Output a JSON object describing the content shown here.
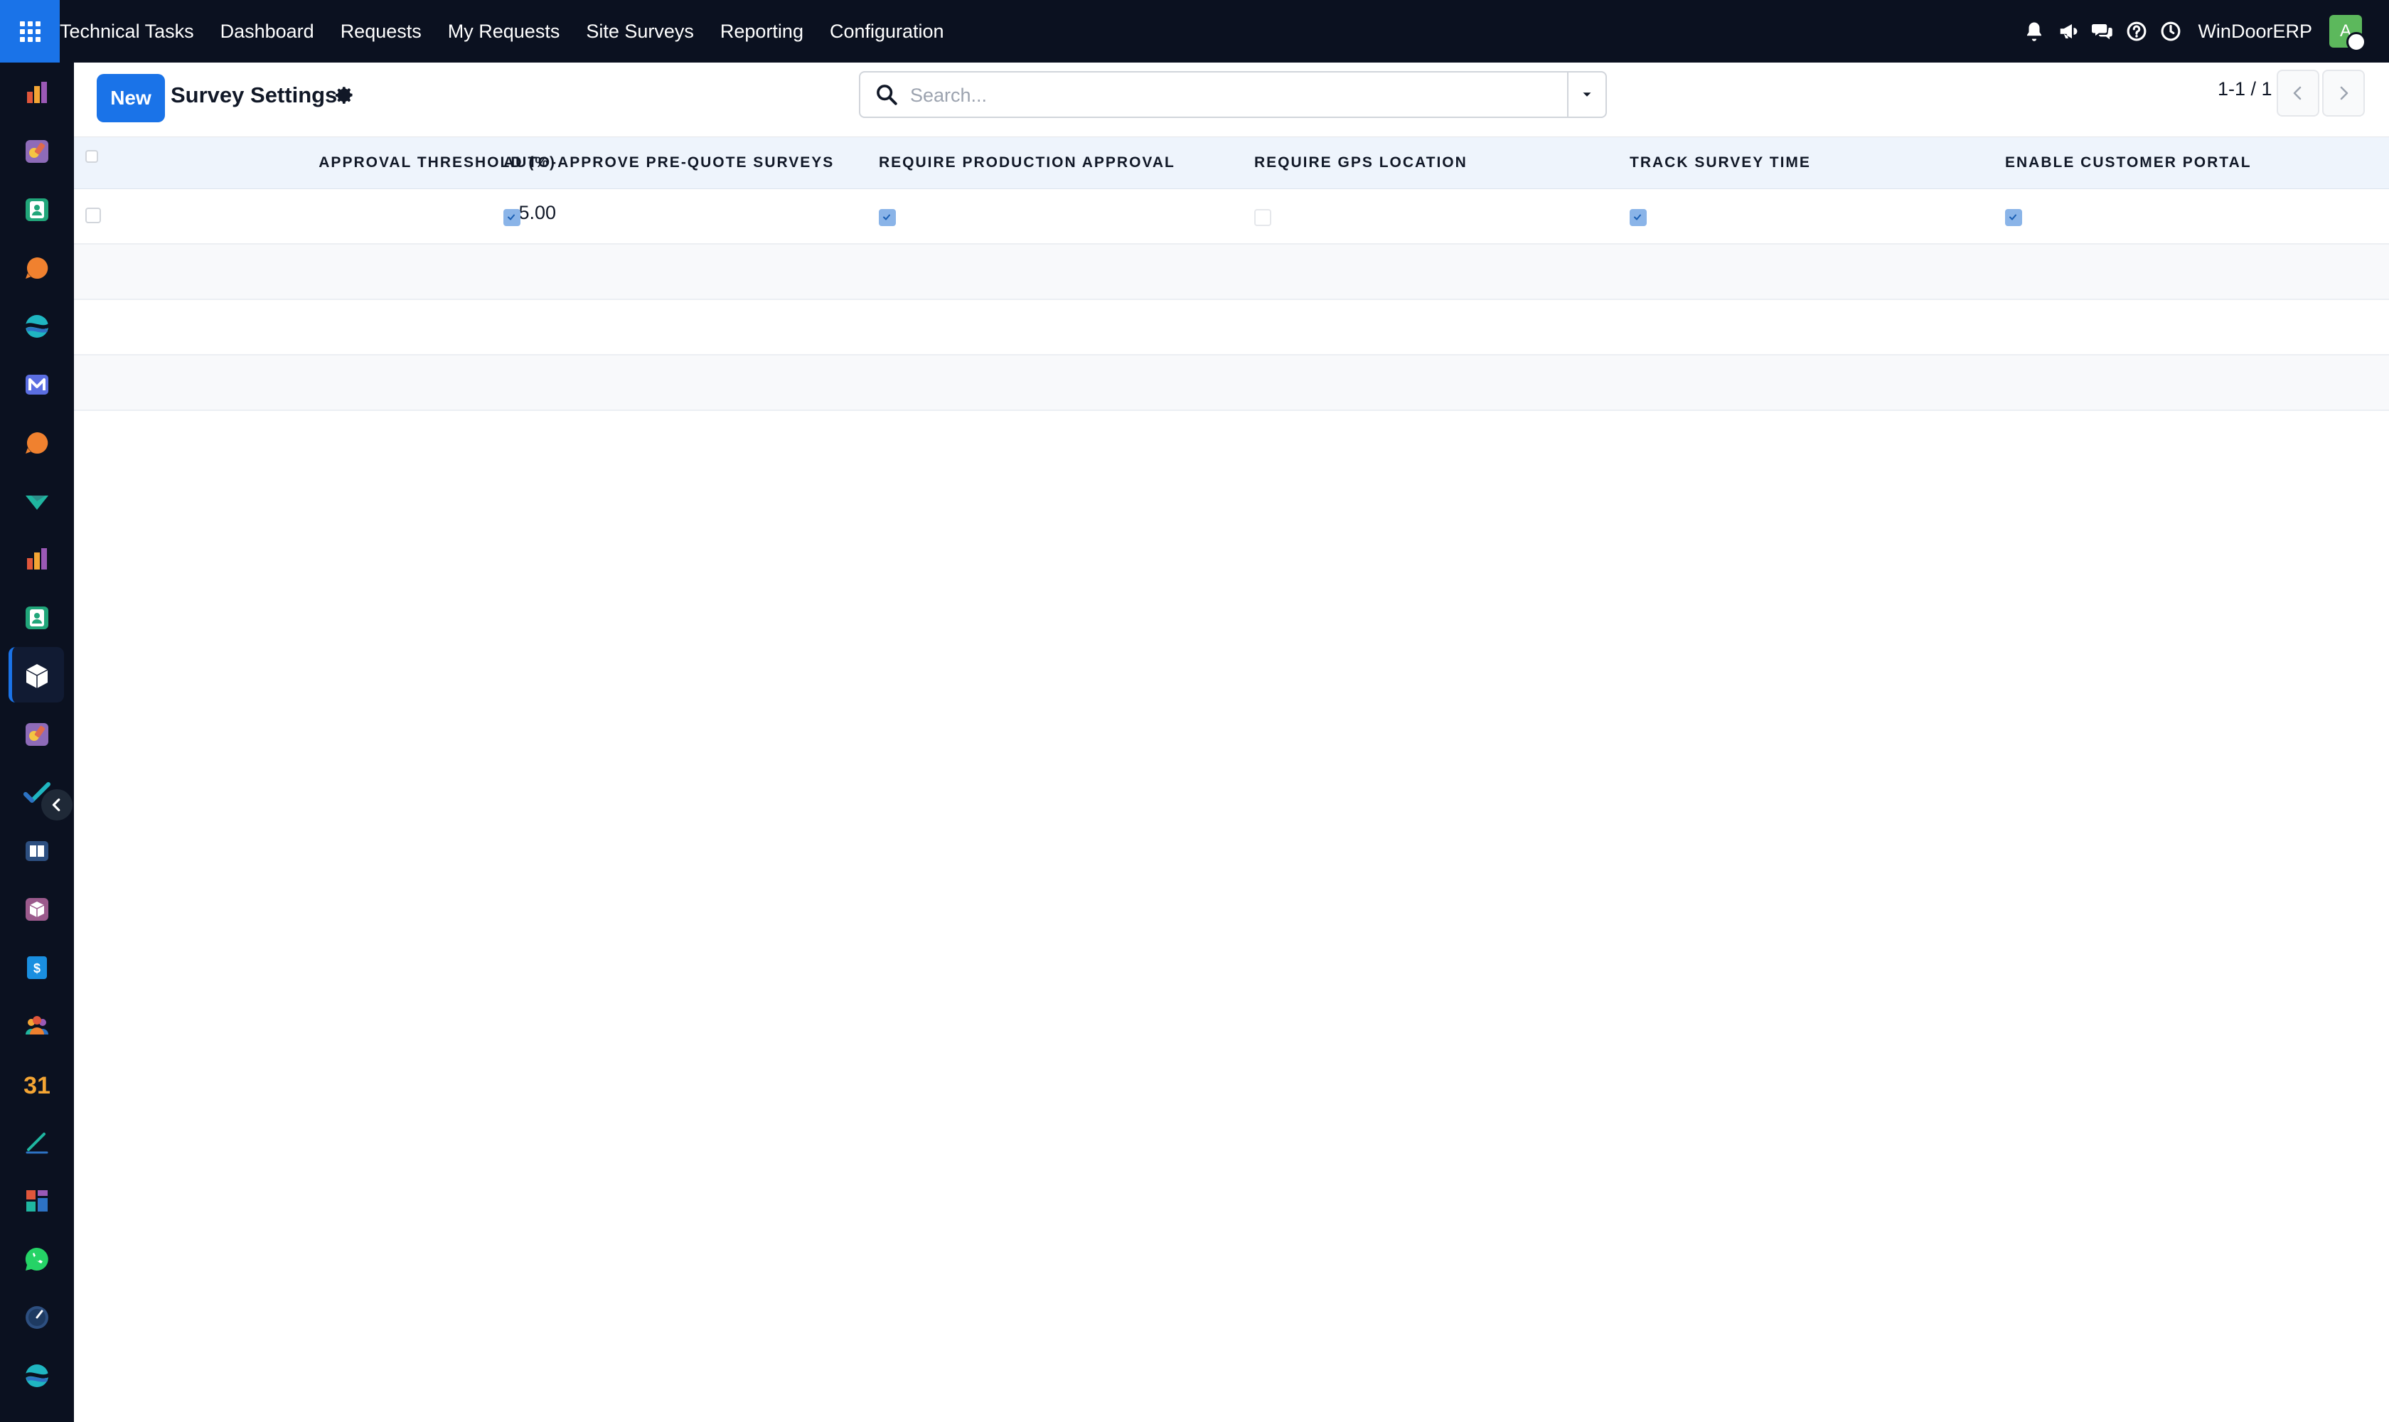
{
  "topbar": {
    "apps_icon": "grid-icon",
    "menu": [
      "Technical Tasks",
      "Dashboard",
      "Requests",
      "My Requests",
      "Site Surveys",
      "Reporting",
      "Configuration"
    ],
    "icons": [
      "bell-icon",
      "megaphone-icon",
      "chat-icon",
      "help-icon",
      "clock-icon"
    ],
    "company": "WinDoorERP",
    "avatar_letter": "A",
    "avatar_color": "#5cb85c"
  },
  "sidebar": {
    "items": [
      "chart-icon",
      "tools-icon",
      "contact-icon",
      "chat-bubble-icon",
      "globe-icon",
      "mail-icon",
      "chat-bubble-icon",
      "check-shield-icon",
      "chart-icon",
      "contact-icon",
      "box-icon",
      "tools-icon",
      "checkmark-icon",
      "book-icon",
      "package-icon",
      "invoice-icon",
      "people-icon",
      "calendar-icon",
      "sign-icon",
      "dashboard-icon",
      "whatsapp-icon",
      "timer-icon",
      "globe-icon"
    ],
    "active_index": 10,
    "collapse_icon": "chevron-left-icon"
  },
  "control_panel": {
    "new_label": "New",
    "title": "Survey Settings",
    "search_placeholder": "Search...",
    "pager": "1-1 / 1"
  },
  "table": {
    "columns": [
      "Approval Threshold (%)",
      "Auto-Approve Pre-Quote Surveys",
      "Require Production Approval",
      "Require GPS Location",
      "Track Survey Time",
      "Enable Customer Portal"
    ],
    "rows": [
      {
        "threshold": "5.00",
        "auto_approve": true,
        "require_production": true,
        "require_gps": false,
        "track_time": true,
        "customer_portal": true
      }
    ]
  },
  "colors": {
    "topbar_bg": "#0b1120",
    "accent": "#1a73e8",
    "header_bg": "#eef4fc",
    "checkbox_checked": "#8ab4e8"
  }
}
